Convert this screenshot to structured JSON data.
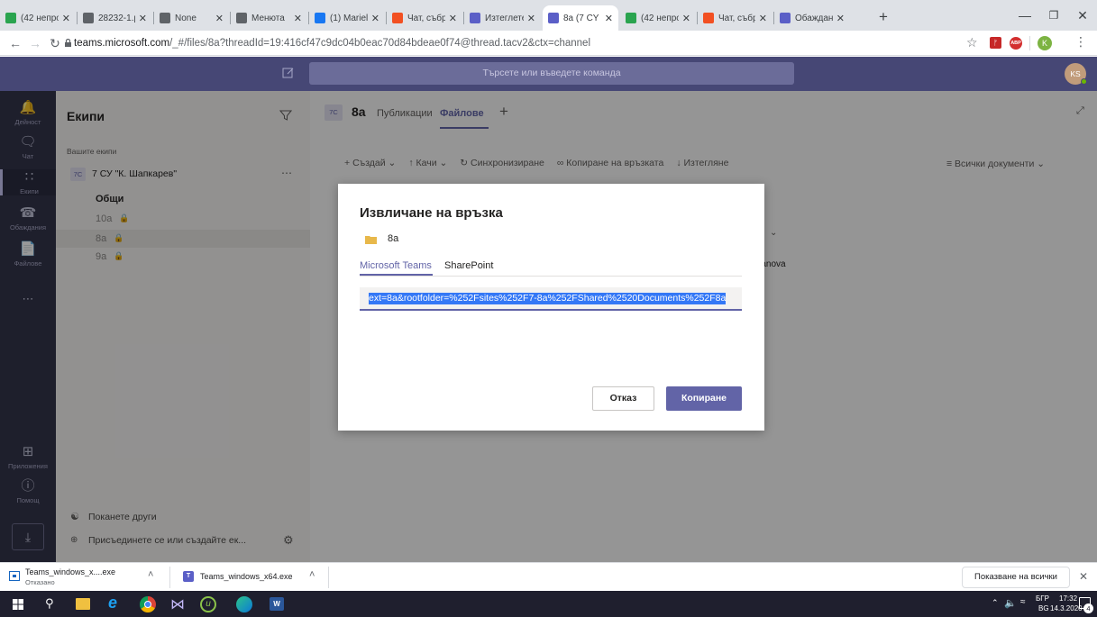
{
  "browser": {
    "tabs": [
      {
        "title": "(42 непро",
        "icon": "home-icon",
        "color": "#2aa44f"
      },
      {
        "title": "28232-1.p",
        "icon": "globe-icon",
        "color": "#5f6368"
      },
      {
        "title": "None",
        "icon": "globe-icon",
        "color": "#5f6368"
      },
      {
        "title": "Менюта",
        "icon": "globe-icon",
        "color": "#5f6368"
      },
      {
        "title": "(1) Mariel",
        "icon": "facebook-icon",
        "color": "#1877f2"
      },
      {
        "title": "Чат, събр",
        "icon": "microsoft-icon",
        "color": "#f25022"
      },
      {
        "title": "Изтеглете",
        "icon": "teams-icon",
        "color": "#5b5fc7"
      },
      {
        "title": "8a (7 CY",
        "icon": "teams-icon",
        "color": "#5b5fc7"
      },
      {
        "title": "(42 непро",
        "icon": "home-icon",
        "color": "#2aa44f"
      },
      {
        "title": "Чат, събр",
        "icon": "microsoft-icon",
        "color": "#f25022"
      },
      {
        "title": "Обаждан",
        "icon": "teams-icon",
        "color": "#5b5fc7"
      }
    ],
    "new_tab": "+",
    "url_host": "teams.microsoft.com",
    "url_rest": "/_#/files/8a?threadId=19:416cf47c9dc04b0eac70d84bdeae0f74@thread.tacv2&ctx=channel",
    "profile_initial": "K"
  },
  "teams": {
    "search_placeholder": "Търсете или въведете команда",
    "user_initials": "KS",
    "rail": [
      {
        "label": "Дейност",
        "icon": "bell-icon"
      },
      {
        "label": "Чат",
        "icon": "chat-icon"
      },
      {
        "label": "Екипи",
        "icon": "teams-icon"
      },
      {
        "label": "Обаждания",
        "icon": "phone-icon"
      },
      {
        "label": "Файлове",
        "icon": "files-icon"
      },
      {
        "label": "...",
        "icon": "more-icon"
      }
    ],
    "rail_bottom": [
      {
        "label": "Приложения",
        "icon": "apps-icon"
      },
      {
        "label": "Помощ",
        "icon": "help-icon"
      }
    ],
    "panel_title": "Екипи",
    "your_teams": "Вашите екипи",
    "team_badge": "7С",
    "team_name": "7 СУ \"К. Шапкарев\"",
    "channels": [
      {
        "name": "Общи",
        "locked": false,
        "bold": true
      },
      {
        "name": "10а",
        "locked": true,
        "bold": false
      },
      {
        "name": "8а",
        "locked": true,
        "bold": false
      },
      {
        "name": "9а",
        "locked": true,
        "bold": false
      }
    ],
    "invite_label": "Поканете други",
    "join_label": "Присъединете се или създайте ек...",
    "channel_badge": "7С",
    "channel_title": "8а",
    "channel_tabs": [
      {
        "label": "Публикации",
        "active": false
      },
      {
        "label": "Файлове",
        "active": true
      }
    ],
    "toolbar": [
      {
        "label": "Създай",
        "icon": "plus-icon"
      },
      {
        "label": "Качи",
        "icon": "upload-icon"
      },
      {
        "label": "Синхронизиране",
        "icon": "sync-icon"
      },
      {
        "label": "Копиране на връзката",
        "icon": "link-icon"
      },
      {
        "label": "Изтегляне",
        "icon": "download-icon"
      }
    ],
    "all_documents": "Всички документи",
    "bg_text": "manova"
  },
  "dialog": {
    "title": "Извличане на връзка",
    "folder": "8a",
    "tabs": [
      {
        "label": "Microsoft Teams",
        "active": true
      },
      {
        "label": "SharePoint",
        "active": false
      }
    ],
    "link_value": "ext=8a&rootfolder=%252Fsites%252F7-8a%252FShared%2520Documents%252F8a",
    "cancel_label": "Отказ",
    "copy_label": "Копиране"
  },
  "downloads": {
    "items": [
      {
        "name": "Teams_windows_x....exe",
        "status": "Отказано"
      },
      {
        "name": "Teams_windows_x64.exe",
        "status": ""
      }
    ],
    "show_all": "Показване на всички"
  },
  "taskbar": {
    "lang": "БГР",
    "lang2": "BG",
    "time": "17:32",
    "date": "14.3.2020 г.",
    "notif_count": "4"
  },
  "colors": {
    "teams_purple": "#464775",
    "rail": "#33344a",
    "accent": "#6264a7"
  }
}
